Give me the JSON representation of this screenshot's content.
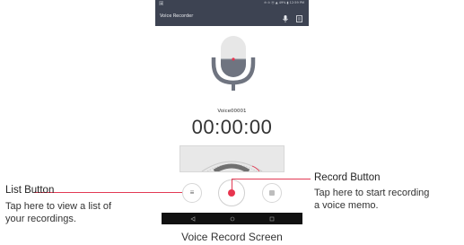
{
  "status_bar": {
    "left_text": "🖼",
    "right_text": "⊖ ⊙ ⦿ ▲ 49% ▮ 12:59 PM"
  },
  "app_bar": {
    "title": "Voice Recorder",
    "icons": [
      "mic-icon",
      "list-icon"
    ]
  },
  "recording": {
    "filename": "Voice00001",
    "timer": "00:00:00"
  },
  "controls": {
    "list_glyph": "≡",
    "icons": [
      "list-icon",
      "record-icon",
      "stop-icon"
    ]
  },
  "nav_bar": {
    "icons": [
      "back-icon",
      "home-icon",
      "recent-apps-icon"
    ]
  },
  "callouts": {
    "list": {
      "title": "List Button",
      "desc_line1": "Tap here to view a list of",
      "desc_line2": "your recordings."
    },
    "record": {
      "title": "Record Button",
      "desc_line1": "Tap here to start recording",
      "desc_line2": "a voice memo."
    }
  },
  "caption": "Voice Record Screen",
  "colors": {
    "app_bar": "#3d4352",
    "accent_red": "#e8344e",
    "callout_line": "#e23a54",
    "mic_gray": "#6f7480"
  }
}
